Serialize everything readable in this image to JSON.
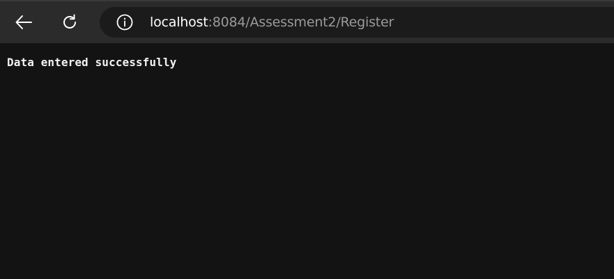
{
  "toolbar": {
    "back_icon": "back-arrow-icon",
    "reload_icon": "reload-icon",
    "site_info_icon": "info-icon"
  },
  "address": {
    "host": "localhost",
    "rest": ":8084/Assessment2/Register"
  },
  "page": {
    "message": "Data entered successfully"
  },
  "colors": {
    "toolbar_bg": "#2b2b2b",
    "address_bg": "#1b1b1b",
    "page_bg": "#131313",
    "host_text": "#ffffff",
    "path_text": "#9a9a9a"
  }
}
